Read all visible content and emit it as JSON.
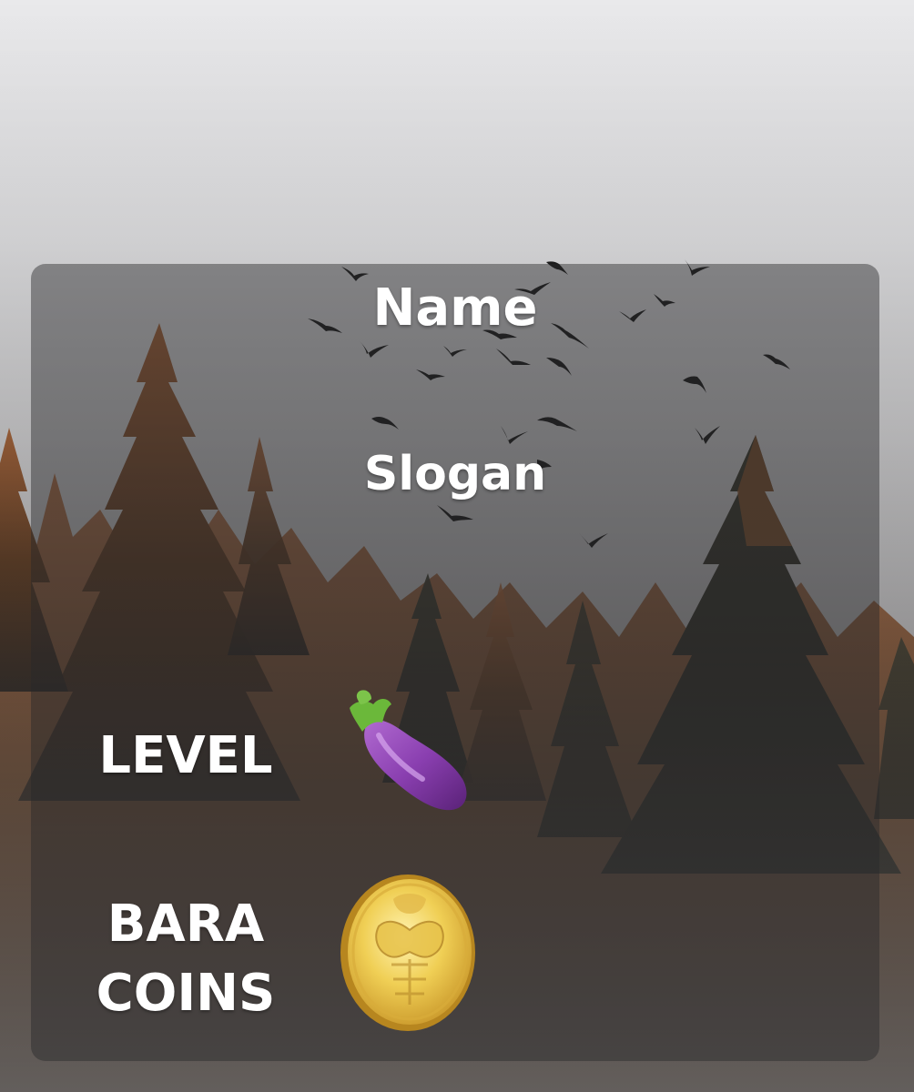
{
  "profile": {
    "name": "Name",
    "slogan": "Slogan"
  },
  "stats": {
    "level_label": "LEVEL",
    "level_icon": "eggplant-icon",
    "coins_label_line1": "BARA",
    "coins_label_line2": "COINS",
    "coins_icon": "gold-coin-icon"
  },
  "colors": {
    "text": "#ffffff",
    "card_overlay": "rgba(40,40,42,0.45)",
    "eggplant": "#8a3fb0",
    "coin": "#e7c24a"
  }
}
